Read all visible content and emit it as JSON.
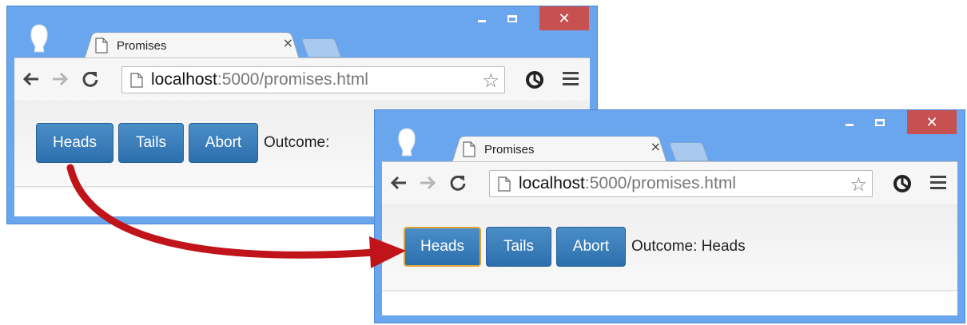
{
  "windows": [
    {
      "tab_title": "Promises",
      "tab_close": "×",
      "url_host": "localhost",
      "url_rest": ":5000/promises.html",
      "buttons": {
        "heads": "Heads",
        "tails": "Tails",
        "abort": "Abort"
      },
      "outcome_label": "Outcome:",
      "outcome_value": ""
    },
    {
      "tab_title": "Promises",
      "tab_close": "×",
      "url_host": "localhost",
      "url_rest": ":5000/promises.html",
      "buttons": {
        "heads": "Heads",
        "tails": "Tails",
        "abort": "Abort"
      },
      "outcome_label": "Outcome:",
      "outcome_value": "Heads"
    }
  ],
  "icons": {
    "back": "back-arrow-icon",
    "forward": "forward-arrow-icon",
    "reload": "reload-icon",
    "page": "page-icon",
    "bookmark": "star-icon",
    "extension": "extension-icon",
    "menu": "hamburger-menu-icon",
    "arrow": "red-curved-arrow"
  },
  "colors": {
    "window_frame": "#6aa6ee",
    "close_button": "#c75050",
    "button_blue": "#337ab7",
    "focus_ring": "#e0a53a",
    "annotation_arrow": "#c0141a"
  }
}
